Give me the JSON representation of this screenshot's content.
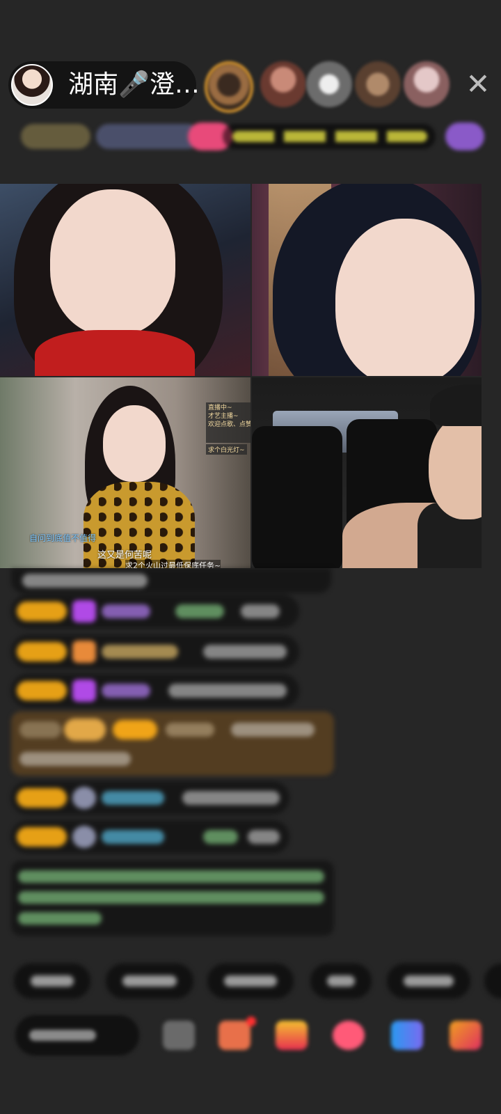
{
  "header": {
    "host_name": "湖南🎤澄…",
    "close_icon_glyph": "✕"
  },
  "stream_tiles": [
    {
      "id": "guest-1"
    },
    {
      "id": "guest-2"
    },
    {
      "id": "guest-3",
      "overlay_note_lines": [
        "直播中~",
        "才艺主播~",
        "欢迎点歌、点赞"
      ],
      "overlay_note_footer": "求个白光灯~",
      "caption_top": "自问到底值不值得",
      "caption_middle": "这又是何苦呢",
      "caption_bottom": "求2个火山过最低保底任务~"
    },
    {
      "id": "guest-4"
    }
  ],
  "colors": {
    "background": "#262626",
    "badge_gold": "#e6a016",
    "accent_purple": "#b04ae6",
    "accent_pink": "#e84a7a"
  },
  "icons": {
    "close": "close-icon",
    "gift": "gift-icon",
    "emoji": "emoji-icon",
    "share": "share-icon",
    "more": "more-icon"
  }
}
